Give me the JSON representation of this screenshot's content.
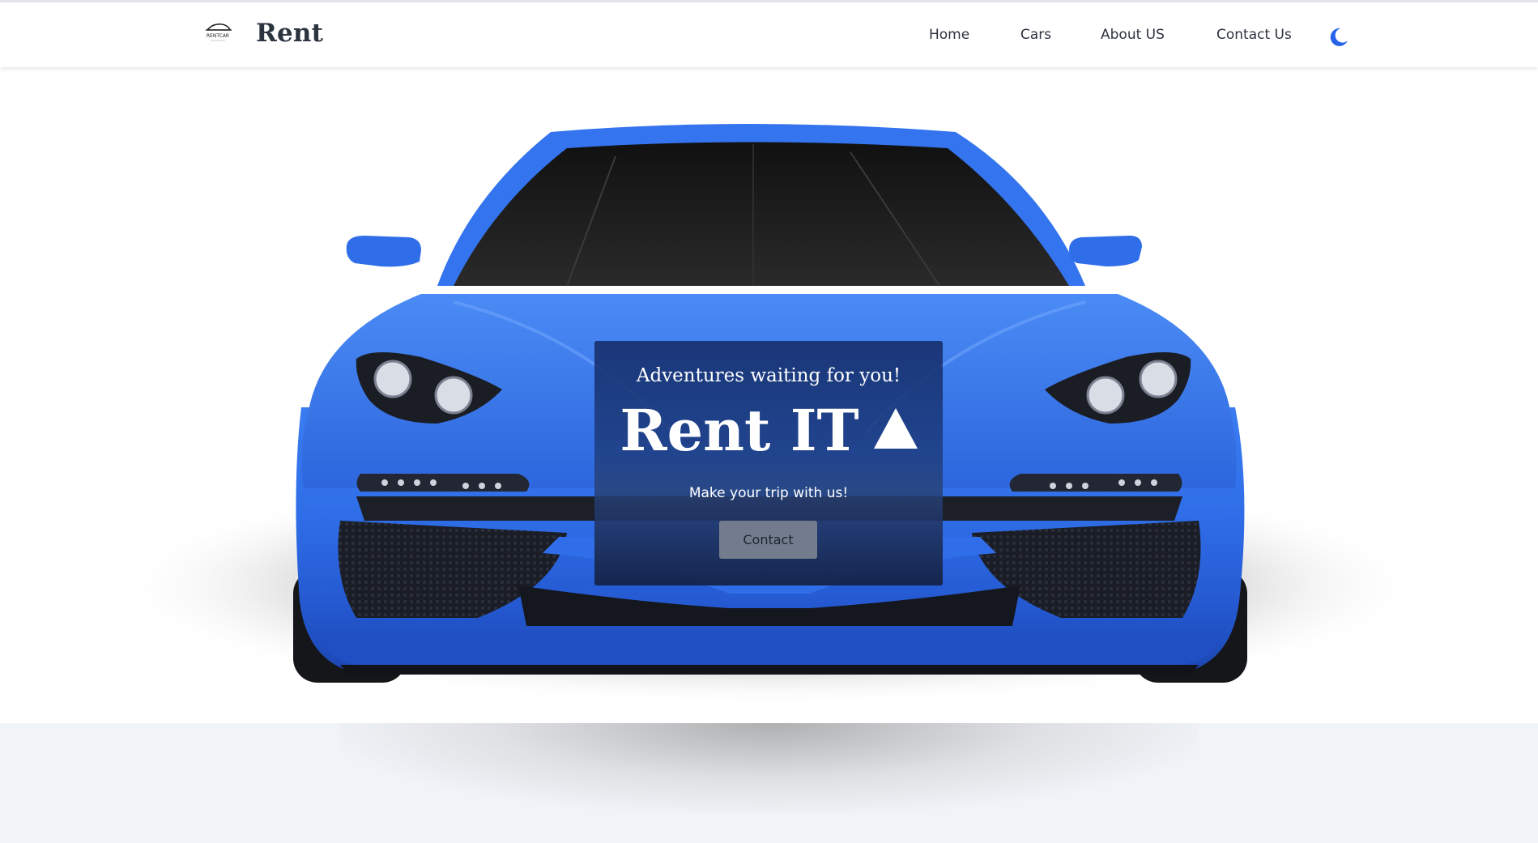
{
  "header": {
    "logo_text": "RENTCAR",
    "brand": "Rent",
    "nav": [
      {
        "label": "Home"
      },
      {
        "label": "Cars"
      },
      {
        "label": "About US"
      },
      {
        "label": "Contact Us"
      }
    ],
    "theme_icon": "moon-icon"
  },
  "hero": {
    "tagline": "Adventures waiting for you!",
    "title": "Rent IT",
    "title_icon": "triangle-up-icon",
    "subtitle": "Make your trip with us!",
    "button_label": "Contact",
    "image": "blue-sports-car"
  },
  "colors": {
    "accent": "#2563eb",
    "car_blue": "#2f6ee8",
    "card_bg": "#1c3a7e",
    "button_bg": "#727c8c",
    "footer_bg": "#f0f3f7",
    "text_dark": "#2d3340"
  }
}
